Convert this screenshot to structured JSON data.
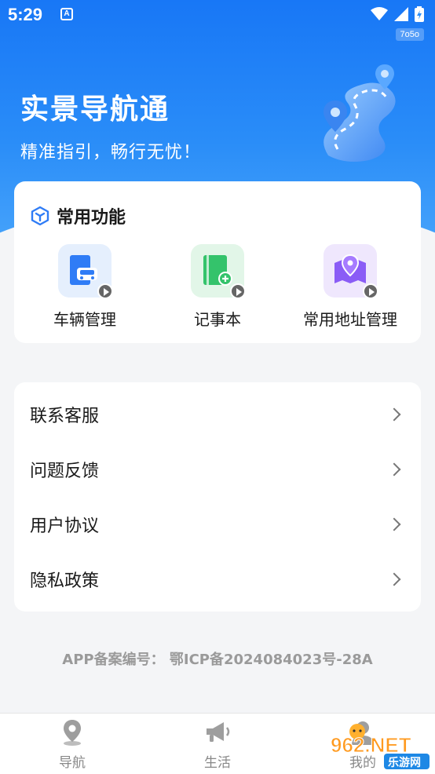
{
  "status_bar": {
    "time": "5:29",
    "notification_icon": "A",
    "app_tag": "7o5o"
  },
  "hero": {
    "title": "实景导航通",
    "slogan": "精准指引，畅行无忧！",
    "illustration": "map-road-pin-icon"
  },
  "functions": {
    "title": "常用功能",
    "items": [
      {
        "label": "车辆管理",
        "icon": "vehicle-icon",
        "color": "#2f7cf6",
        "bg": "#e5effd"
      },
      {
        "label": "记事本",
        "icon": "notebook-icon",
        "color": "#34c36b",
        "bg": "#e2f6e8"
      },
      {
        "label": "常用地址管理",
        "icon": "map-pin-icon",
        "color": "#8a5cf6",
        "bg": "#efe7fd"
      }
    ]
  },
  "menu": {
    "items": [
      {
        "label": "联系客服"
      },
      {
        "label": "问题反馈"
      },
      {
        "label": "用户协议"
      },
      {
        "label": "隐私政策"
      }
    ]
  },
  "beian": "APP备案编号： 鄂ICP备2024084023号-28A",
  "tabbar": {
    "items": [
      {
        "label": "导航",
        "icon": "location-pin-icon"
      },
      {
        "label": "生活",
        "icon": "megaphone-icon"
      },
      {
        "label": "我的",
        "icon": "user-icon"
      }
    ]
  },
  "watermark": {
    "brand": "962.NET",
    "sub": "乐游网"
  },
  "colors": {
    "hero_top": "#1877f6",
    "hero_bottom": "#4aa6fb",
    "background": "#f4f5f7"
  }
}
